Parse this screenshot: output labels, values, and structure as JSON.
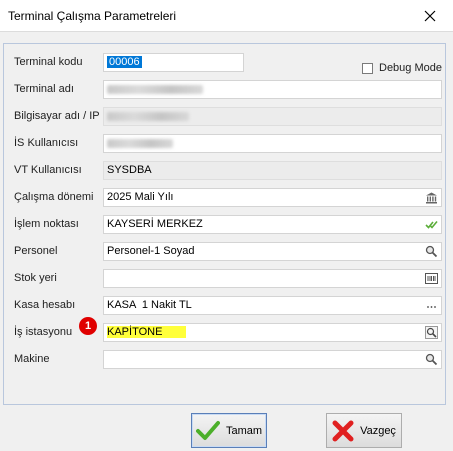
{
  "window": {
    "title": "Terminal Çalışma Parametreleri"
  },
  "debug_mode": {
    "label": "Debug Mode",
    "checked": false
  },
  "fields": {
    "terminal_kodu": {
      "label": "Terminal kodu",
      "value": "00006"
    },
    "terminal_adi": {
      "label": "Terminal adı",
      "value": ""
    },
    "bilgisayar": {
      "label": "Bilgisayar adı / IP",
      "value": ""
    },
    "is_kullanici": {
      "label": "İS Kullanıcısı",
      "value": ""
    },
    "vt_kullanici": {
      "label": "VT Kullanıcısı",
      "value": "SYSDBA"
    },
    "calisma_donemi": {
      "label": "Çalışma dönemi",
      "value": "2025 Mali Yılı"
    },
    "islem_noktasi": {
      "label": "İşlem noktası",
      "value": "KAYSERİ MERKEZ"
    },
    "personel": {
      "label": "Personel",
      "value": "Personel-1 Soyad"
    },
    "stok_yeri": {
      "label": "Stok yeri",
      "value": ""
    },
    "kasa_hesabi": {
      "label": "Kasa hesabı",
      "value": "KASA  1 Nakit TL"
    },
    "is_istasyonu": {
      "label": "İş istasyonu",
      "value": "KAPİTONE"
    },
    "makine": {
      "label": "Makine",
      "value": ""
    }
  },
  "annotation": {
    "badge": "1"
  },
  "buttons": {
    "ok": "Tamam",
    "cancel": "Vazgeç"
  },
  "colors": {
    "highlight": "#ffff3a",
    "badge": "#e00000",
    "accent": "#0078d7"
  }
}
